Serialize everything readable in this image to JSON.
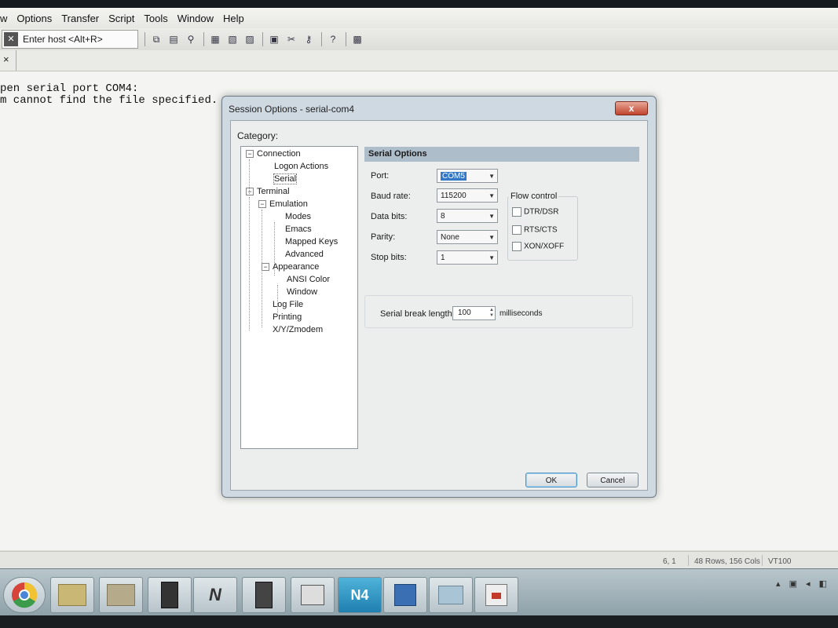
{
  "menu": [
    "w",
    "Options",
    "Transfer",
    "Script",
    "Tools",
    "Window",
    "Help"
  ],
  "toolbar": {
    "host_placeholder": "Enter host <Alt+R>"
  },
  "tab": {
    "close_glyph": "×"
  },
  "terminal": {
    "lines": [
      "pen serial port COM4:",
      "m cannot find the file specified."
    ]
  },
  "dialog": {
    "title": "Session Options - serial-com4",
    "close_glyph": "x",
    "category_label": "Category:",
    "tree": [
      "Connection",
      "Logon Actions",
      "Serial",
      "Terminal",
      "Emulation",
      "Modes",
      "Emacs",
      "Mapped Keys",
      "Advanced",
      "Appearance",
      "ANSI Color",
      "Window",
      "Log File",
      "Printing",
      "X/Y/Zmodem"
    ],
    "section_title": "Serial Options",
    "port": {
      "label": "Port:",
      "value": "COM5"
    },
    "baud_rate": {
      "label": "Baud rate:",
      "value": "115200"
    },
    "data_bits": {
      "label": "Data bits:",
      "value": "8"
    },
    "parity": {
      "label": "Parity:",
      "value": "None"
    },
    "stop_bits": {
      "label": "Stop bits:",
      "value": "1"
    },
    "flow_control": {
      "title": "Flow control",
      "options": [
        "DTR/DSR",
        "RTS/CTS",
        "XON/XOFF"
      ]
    },
    "serial_break": {
      "label": "Serial break length:",
      "value": "100",
      "unit": "milliseconds"
    },
    "ok_label": "OK",
    "cancel_label": "Cancel"
  },
  "status": {
    "cursor": "6,  1",
    "rows_cols": "48 Rows, 156 Cols",
    "emulation": "VT100"
  },
  "taskbar": {
    "n_label": "N",
    "n4_label": "N4"
  },
  "colors": {
    "selection": "#3478c8",
    "close_button": "#c0442d",
    "section_header": "#aebdca"
  }
}
